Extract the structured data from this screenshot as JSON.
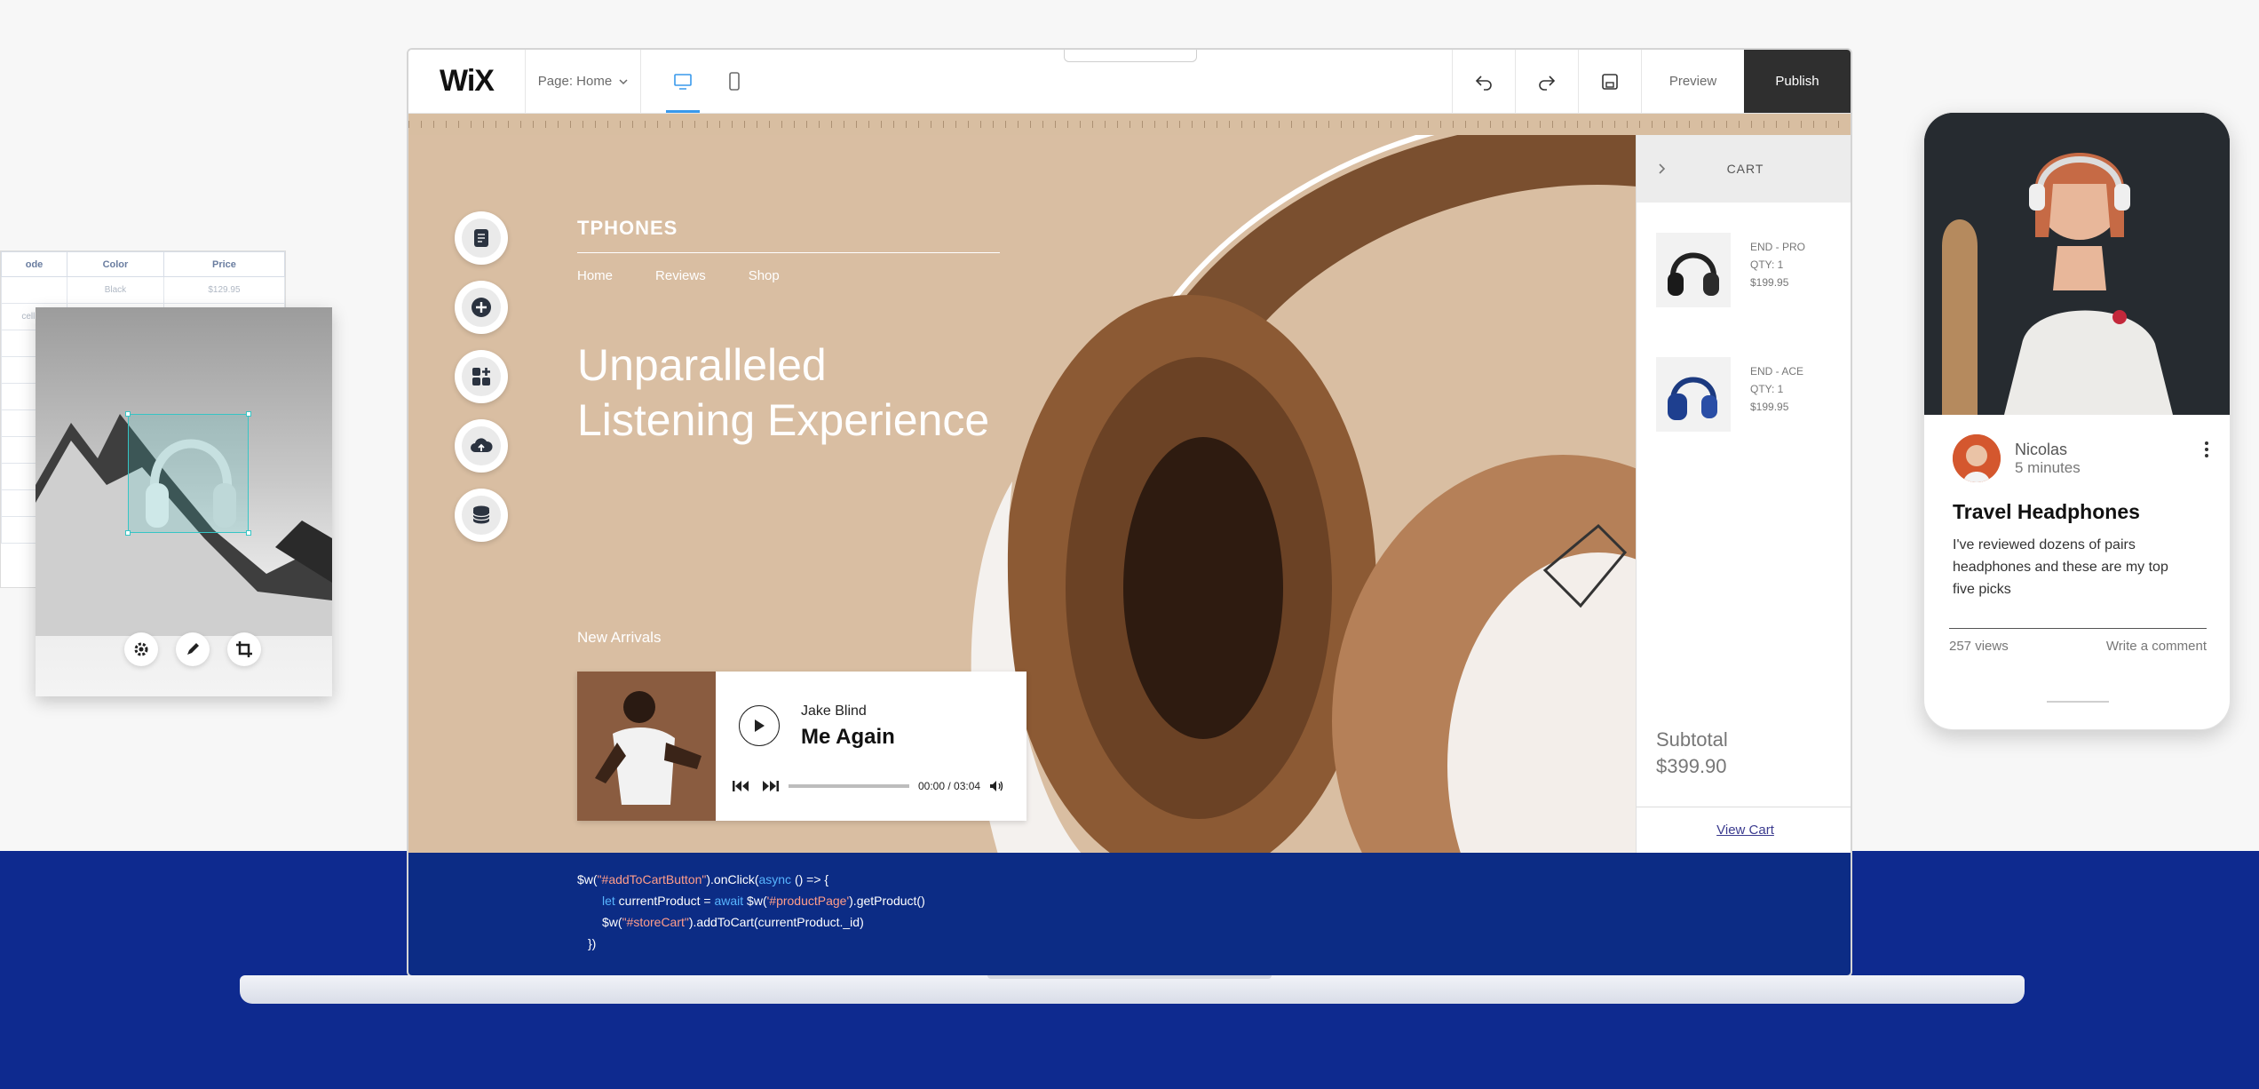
{
  "background": {
    "band_color": "#0e2a8f"
  },
  "left_table": {
    "headers": [
      "ode",
      "Color",
      "Price"
    ],
    "rows": [
      [
        "",
        "Black",
        "$129.95"
      ],
      [
        "celling",
        "",
        ""
      ],
      [
        "",
        "",
        ""
      ],
      [
        "",
        "",
        ""
      ]
    ]
  },
  "image_editor": {
    "tools": [
      {
        "icon": "gear-icon",
        "label": "Settings"
      },
      {
        "icon": "pen-icon",
        "label": "Edit"
      },
      {
        "icon": "crop-icon",
        "label": "Crop"
      }
    ],
    "selection_color": "#36c5c5"
  },
  "editor": {
    "logo": "WiX",
    "page_selector": "Page: Home",
    "devices": [
      {
        "name": "desktop",
        "active": true
      },
      {
        "name": "mobile",
        "active": false
      }
    ],
    "toolbar_icons": [
      "undo",
      "redo",
      "save"
    ],
    "preview_label": "Preview",
    "publish_label": "Publish",
    "accent_color": "#3899ec"
  },
  "left_panel_tools": [
    {
      "name": "pages",
      "icon": "pages-icon"
    },
    {
      "name": "add",
      "icon": "add-icon"
    },
    {
      "name": "add-apps",
      "icon": "apps-icon"
    },
    {
      "name": "upload",
      "icon": "cloud-upload-icon"
    },
    {
      "name": "database",
      "icon": "database-icon"
    }
  ],
  "site": {
    "brand": "TPHONES",
    "nav": [
      "Home",
      "Reviews",
      "Shop"
    ],
    "hero_title_line1": "Unparalleled",
    "hero_title_line2": "Listening Experience",
    "section_label": "New Arrivals",
    "background_color": "#d9bea2"
  },
  "player": {
    "artist": "Jake Blind",
    "track": "Me Again",
    "time_current": "00:00",
    "time_total": "03:04",
    "time_separator": " / ",
    "progress_fraction": 0.0
  },
  "cart": {
    "title": "CART",
    "items": [
      {
        "name": "END - PRO",
        "qty": "QTY: 1",
        "price": "$199.95"
      },
      {
        "name": "END - ACE",
        "qty": "QTY: 1",
        "price": "$199.95"
      }
    ],
    "subtotal_label": "Subtotal",
    "subtotal_value": "$399.90",
    "view_cart_label": "View Cart"
  },
  "code": {
    "line1_a": "$w(",
    "line1_str": "\"#addToCartButton\"",
    "line1_b": ").onClick(",
    "line1_kw": "async",
    "line1_c": " () => {",
    "line2_kw1": "let",
    "line2_a": " currentProduct = ",
    "line2_kw2": "await",
    "line2_b": " $w(",
    "line2_str": "'#productPage'",
    "line2_c": ").getProduct()",
    "line3_a": "$w(",
    "line3_str": "\"#storeCart\"",
    "line3_b": ").addToCart(currentProduct._id)",
    "line4": "})"
  },
  "blog_post": {
    "author": "Nicolas",
    "time_ago": "5 minutes",
    "title": "Travel Headphones",
    "excerpt": "I've reviewed dozens of pairs headphones and these are my top five picks",
    "views": "257 views",
    "comment_link": "Write a comment"
  }
}
